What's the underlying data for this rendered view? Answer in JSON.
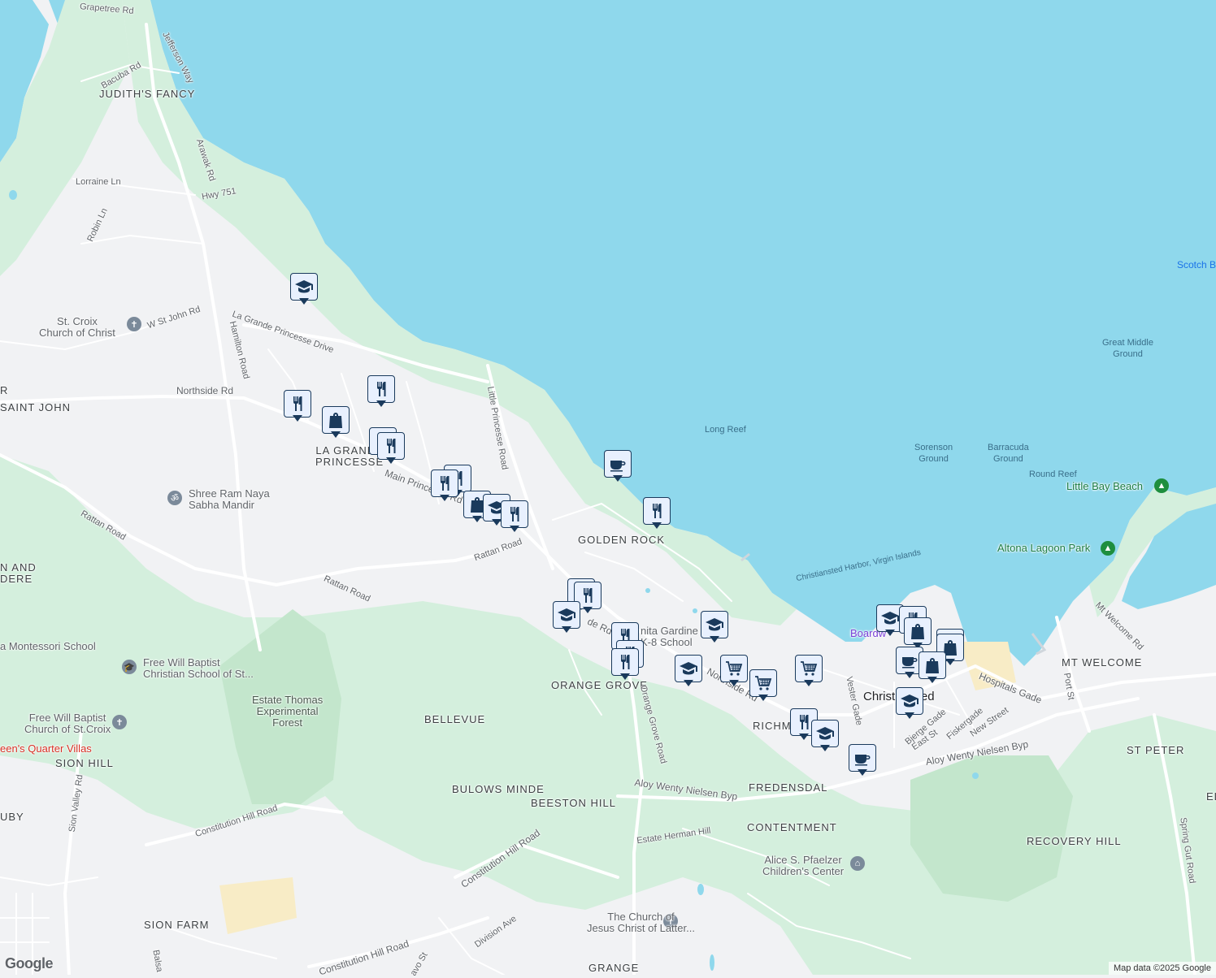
{
  "map": {
    "attribution": "Map data ©2025 Google",
    "logo": "Google",
    "colors": {
      "water": "#8fd8ec",
      "land": "#f1f2f4",
      "green": "#d4efdd",
      "forest": "#c3e6cc",
      "road": "#ffffff",
      "pin_fill": "#e8f0fe",
      "pin_border": "#1a3a5c",
      "park_icon": "#1e8e3e"
    }
  },
  "areas": {
    "judiths_fancy": "JUDITH'S FANCY",
    "saint_john": "SAINT JOHN",
    "la_grande_princesse": "LA GRANDE\nPRINCESSE",
    "golden_rock": "GOLDEN ROCK",
    "orange_grove": "ORANGE GROVE",
    "bellevue": "BELLEVUE",
    "bulows_minde": "BULOWS MINDE",
    "beeston_hill": "BEESTON HILL",
    "fredensdal": "FREDENSDAL",
    "contentment": "CONTENTMENT",
    "richmond": "RICHM",
    "mt_welcome": "MT WELCOME",
    "st_peter": "ST PETER",
    "recovery_hill": "RECOVERY HILL",
    "sion_hill": "SION HILL",
    "sion_farm": "SION FARM",
    "grange": "GRANGE",
    "land_and_dere": "N AND\nDERE",
    "ruby": "UBY",
    "eliza": "ELIZA",
    "christiansted": "Christiansted",
    "r_left": "R"
  },
  "roads": {
    "grapetree": "Grapetree Rd",
    "jefferson": "Jefferson Way",
    "bacuba": "Bacuba Rd",
    "arawak": "Arawak Rd",
    "lorraine": "Lorraine Ln",
    "hwy751": "Hwy 751",
    "robin": "Robin Ln",
    "w_st_john": "W St John Rd",
    "la_grande_princesse_dr": "La Grande Princesse Drive",
    "hamilton": "Hamilton Road",
    "northside": "Northside Rd",
    "little_princesse": "Little Princesse Road",
    "main_princesse": "Main Princesse Rd",
    "rattan1": "Rattan Road",
    "rattan2": "Rattan Road",
    "rattan3": "Rattan Road",
    "orange_grove_rd": "Orange Grove Road",
    "northside_rd2": "Northside Rd",
    "vester": "Vester Gade",
    "bjerge": "Bjerge Gade",
    "east_st": "East St",
    "fiskergade": "Fiskergade",
    "new_street": "New Street",
    "hospitals": "Hospitals Gade",
    "port_st": "Port St",
    "mt_welcome_rd": "Mt Welcome Rd",
    "aloy1": "Aloy Wenty Nielsen Byp",
    "aloy2": "Aloy Wenty Nielsen Byp",
    "estate_herman": "Estate Herman Hill",
    "constitution1": "Constitution Hill Road",
    "constitution2": "Constitution Hill Road",
    "constitution3": "Constitution Hill Road",
    "sion_valley": "Sion Valley Rd",
    "division": "Division Ave",
    "spring_gut": "Spring Gut Road",
    "ond_rd": "de Rd",
    "balsa": "Balsa",
    "avo": "avo St"
  },
  "pois": {
    "stcroix_church": "St. Croix\nChurch of Christ",
    "shree_ram": "Shree Ram Naya\nSabha Mandir",
    "montessori": "a Montessori School",
    "free_will_school": "Free Will Baptist\nChristian School of St...",
    "free_will_church": "Free Will Baptist\nChurch of St.Croix",
    "queens_quarter": "een's Quarter Villas",
    "estate_thomas": "Estate Thomas\nExperimental\nForest",
    "juanita": "nita Gardine\nK-8 School",
    "alice": "Alice S. Pfaelzer\nChildren's Center",
    "church_latter": "The Church of\nJesus Christ of Latter...",
    "little_bay": "Little Bay Beach",
    "altona": "Altona Lagoon Park",
    "boardwalk": "Boardw"
  },
  "water_labels": {
    "scotch": "Scotch B",
    "great_middle": "Great Middle\nGround",
    "long_reef": "Long Reef",
    "sorenson": "Sorenson\nGround",
    "barracuda": "Barracuda\nGround",
    "round_reef": "Round Reef",
    "harbor": "Christiansted Harbor, Virgin Islands"
  },
  "pins": [
    {
      "icon": "school"
    },
    {
      "icon": "restaurant"
    },
    {
      "icon": "restaurant"
    },
    {
      "icon": "shopping"
    },
    {
      "icon": "restaurant"
    },
    {
      "icon": "restaurant"
    },
    {
      "icon": "restaurant"
    },
    {
      "icon": "restaurant"
    },
    {
      "icon": "shopping"
    },
    {
      "icon": "school"
    },
    {
      "icon": "restaurant"
    },
    {
      "icon": "cafe"
    },
    {
      "icon": "restaurant"
    },
    {
      "icon": "restaurant"
    },
    {
      "icon": "restaurant"
    },
    {
      "icon": "school"
    },
    {
      "icon": "restaurant"
    },
    {
      "icon": "restaurant"
    },
    {
      "icon": "restaurant"
    },
    {
      "icon": "school"
    },
    {
      "icon": "school"
    },
    {
      "icon": "grocery"
    },
    {
      "icon": "grocery"
    },
    {
      "icon": "grocery"
    },
    {
      "icon": "restaurant"
    },
    {
      "icon": "school"
    },
    {
      "icon": "cafe"
    },
    {
      "icon": "school"
    },
    {
      "icon": "restaurant"
    },
    {
      "icon": "shopping"
    },
    {
      "icon": "shopping"
    },
    {
      "icon": "shopping"
    },
    {
      "icon": "cafe"
    },
    {
      "icon": "shopping"
    },
    {
      "icon": "school"
    }
  ]
}
